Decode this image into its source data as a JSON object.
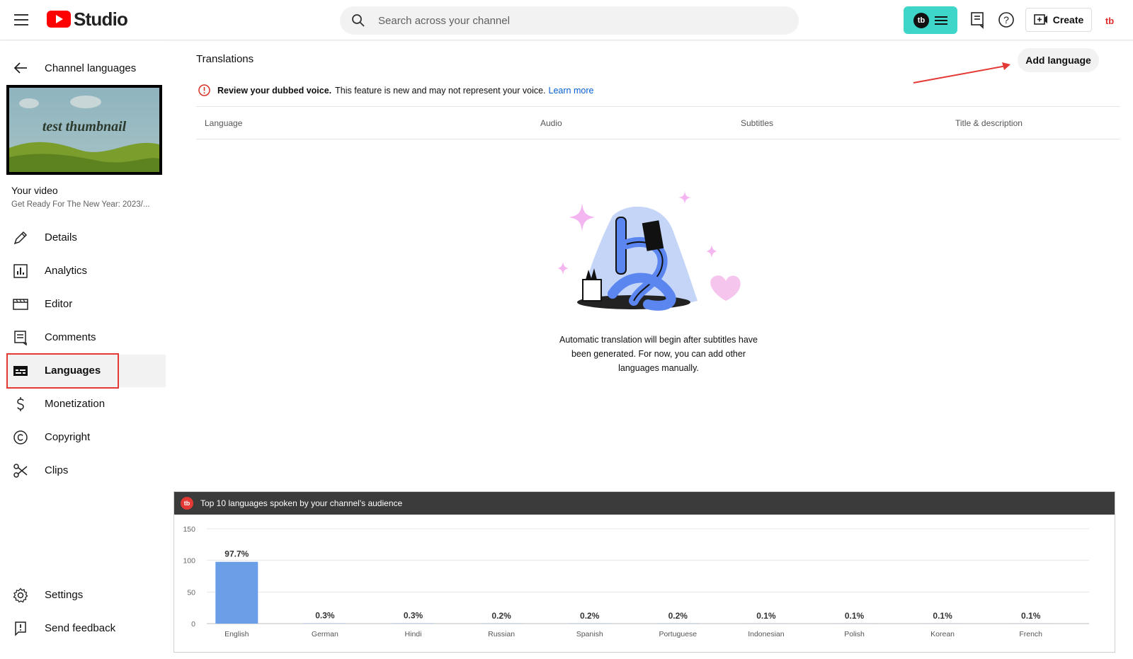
{
  "topbar": {
    "logo_text": "Studio",
    "search_placeholder": "Search across your channel",
    "tb_logo": "tb",
    "create_label": "Create",
    "avatar_text": "tb"
  },
  "sidebar": {
    "back_title": "Channel languages",
    "thumbnail_text": "test thumbnail",
    "your_video_label": "Your video",
    "video_title": "Get Ready For The New Year: 2023/...",
    "items": [
      {
        "label": "Details",
        "icon": "pencil-icon"
      },
      {
        "label": "Analytics",
        "icon": "analytics-icon"
      },
      {
        "label": "Editor",
        "icon": "editor-icon"
      },
      {
        "label": "Comments",
        "icon": "comments-icon"
      },
      {
        "label": "Languages",
        "icon": "subtitles-icon",
        "active": true
      },
      {
        "label": "Monetization",
        "icon": "dollar-icon"
      },
      {
        "label": "Copyright",
        "icon": "copyright-icon"
      },
      {
        "label": "Clips",
        "icon": "scissors-icon"
      }
    ],
    "bottom_items": [
      {
        "label": "Settings",
        "icon": "gear-icon"
      },
      {
        "label": "Send feedback",
        "icon": "feedback-icon"
      }
    ]
  },
  "main": {
    "title": "Translations",
    "add_language_label": "Add language",
    "warning_bold": "Review your dubbed voice.",
    "warning_text": "This feature is new and may not represent your voice.",
    "learn_more": "Learn more",
    "columns": [
      "Language",
      "Audio",
      "Subtitles",
      "Title & description"
    ],
    "empty_state_text": "Automatic translation will begin after subtitles have been generated. For now, you can add other languages manually."
  },
  "chart_panel": {
    "badge": "tb",
    "title": "Top 10 languages spoken by your channel's audience"
  },
  "colors": {
    "accent_teal": "#3ed6c9",
    "brand_red": "#ff0000",
    "bar_blue": "#6a9ee6",
    "link_blue": "#065fd4",
    "annotation_red": "#e53935"
  },
  "chart_data": {
    "type": "bar",
    "title": "Top 10 languages spoken by your channel's audience",
    "categories": [
      "English",
      "German",
      "Hindi",
      "Russian",
      "Spanish",
      "Portuguese",
      "Indonesian",
      "Polish",
      "Korean",
      "French"
    ],
    "values": [
      97.7,
      0.3,
      0.3,
      0.2,
      0.2,
      0.2,
      0.1,
      0.1,
      0.1,
      0.1
    ],
    "labels": [
      "97.7%",
      "0.3%",
      "0.3%",
      "0.2%",
      "0.2%",
      "0.2%",
      "0.1%",
      "0.1%",
      "0.1%",
      "0.1%"
    ],
    "yticks": [
      0,
      50,
      100,
      150
    ],
    "ylim": [
      0,
      150
    ],
    "xlabel": "",
    "ylabel": "",
    "grid": true
  }
}
